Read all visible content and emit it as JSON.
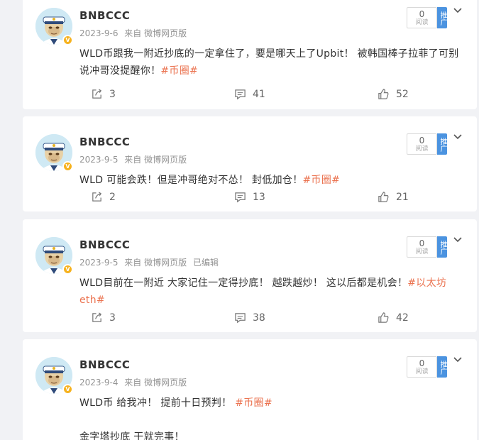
{
  "posts": [
    {
      "username": "BNBCCC",
      "date": "2023-9-6",
      "source": "来自 微博网页版",
      "edited": "",
      "text": "WLD币跟我一附近抄底的一定拿住了，要是哪天上了Upbit！ 被韩国棒子拉菲了可别说冲哥没提醒你！",
      "tag": "#币圈#",
      "text2": "",
      "reads": "0",
      "reads_label": "阅读",
      "promo_label": "推广",
      "shares": "3",
      "comments": "41",
      "likes": "52"
    },
    {
      "username": "BNBCCC",
      "date": "2023-9-5",
      "source": "来自 微博网页版",
      "edited": "",
      "text": "WLD 可能会跌！但是冲哥绝对不怂！ 封低加仓！",
      "tag": "#币圈#",
      "text2": "",
      "reads": "0",
      "reads_label": "阅读",
      "promo_label": "推广",
      "shares": "2",
      "comments": "13",
      "likes": "21"
    },
    {
      "username": "BNBCCC",
      "date": "2023-9-5",
      "source": "来自 微博网页版",
      "edited": "已编辑",
      "text": "WLD目前在一附近  大家记住一定得抄底！  越跌越炒！  这以后都是机会！",
      "tag": "#以太坊eth#",
      "text2": "",
      "reads": "0",
      "reads_label": "阅读",
      "promo_label": "推广",
      "shares": "3",
      "comments": "38",
      "likes": "42"
    },
    {
      "username": "BNBCCC",
      "date": "2023-9-4",
      "source": "来自 微博网页版",
      "edited": "",
      "text": "WLD币 给我冲！  提前十日预判！ ",
      "tag": "#币圈#",
      "text2": "金字塔抄底 干就完事！",
      "reads": "0",
      "reads_label": "阅读",
      "promo_label": "推广",
      "shares": "",
      "comments": "",
      "likes": ""
    }
  ],
  "colors": {
    "tag": "#eb7350",
    "promo": "#4b93e0",
    "verified": "#f6b21e",
    "background": "#f1f2f5"
  },
  "icons": [
    "share-icon",
    "comment-icon",
    "like-icon",
    "chevron-down-icon",
    "verified-icon"
  ]
}
